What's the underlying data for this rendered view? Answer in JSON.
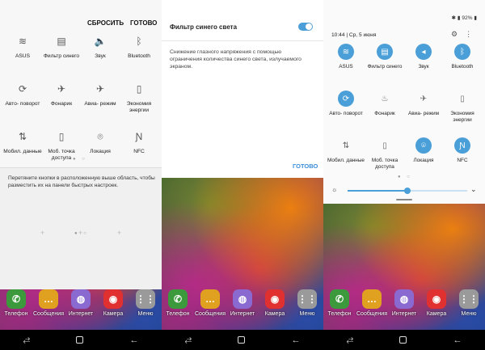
{
  "panel1": {
    "reset_label": "СБРОСИТЬ",
    "done_label": "ГОТОВО",
    "tiles": [
      {
        "label": "ASUS",
        "icon": "wifi-icon",
        "glyph": "≋"
      },
      {
        "label": "Фильтр синего",
        "icon": "blue-filter-icon",
        "glyph": "▤"
      },
      {
        "label": "Звук",
        "icon": "sound-icon",
        "glyph": "🔈"
      },
      {
        "label": "Bluetooth",
        "icon": "bluetooth-icon",
        "glyph": "ᛒ"
      },
      {
        "label": "Авто- поворот",
        "icon": "rotate-icon",
        "glyph": "⟳"
      },
      {
        "label": "Фонарик",
        "icon": "flashlight-icon",
        "glyph": "✈"
      },
      {
        "label": "Авиа- режим",
        "icon": "airplane-icon",
        "glyph": "✈"
      },
      {
        "label": "Экономия энергии",
        "icon": "battery-icon",
        "glyph": "▯"
      },
      {
        "label": "Мобил. данные",
        "icon": "mobile-data-icon",
        "glyph": "⇅"
      },
      {
        "label": "Моб. точка доступа",
        "icon": "hotspot-icon",
        "glyph": "▯"
      },
      {
        "label": "Локация",
        "icon": "location-icon",
        "glyph": "⌾"
      },
      {
        "label": "NFC",
        "icon": "nfc-icon",
        "glyph": "Ɲ"
      }
    ],
    "hint": "Перетяните кнопки в расположенную выше область, чтобы разместить их на панели быстрых настроек."
  },
  "panel2": {
    "title": "Фильтр синего света",
    "description": "Снижение глазного напряжения с помощью ограничения количества синего света, излучаемого экраном.",
    "done_label": "ГОТОВО",
    "toggle_on": true
  },
  "panel3": {
    "battery": "92%",
    "datetime": "10:44 | Ср, 5 июня",
    "tiles": [
      {
        "label": "ASUS",
        "icon": "wifi-icon",
        "glyph": "≋",
        "on": true
      },
      {
        "label": "Фильтр синего",
        "icon": "blue-filter-icon",
        "glyph": "▤",
        "on": true
      },
      {
        "label": "Звук",
        "icon": "sound-icon",
        "glyph": "◂",
        "on": true
      },
      {
        "label": "Bluetooth",
        "icon": "bluetooth-icon",
        "glyph": "ᛒ",
        "on": true
      },
      {
        "label": "Авто- поворот",
        "icon": "rotate-icon",
        "glyph": "⟳",
        "on": true
      },
      {
        "label": "Фонарик",
        "icon": "flashlight-icon",
        "glyph": "♨",
        "on": false
      },
      {
        "label": "Авиа- режим",
        "icon": "airplane-icon",
        "glyph": "✈",
        "on": false
      },
      {
        "label": "Экономия энергии",
        "icon": "battery-icon",
        "glyph": "▯",
        "on": false
      },
      {
        "label": "Мобил. данные",
        "icon": "mobile-data-icon",
        "glyph": "⇅",
        "on": false
      },
      {
        "label": "Моб. точка доступа",
        "icon": "hotspot-icon",
        "glyph": "▯",
        "on": false
      },
      {
        "label": "Локация",
        "icon": "location-icon",
        "glyph": "⌾",
        "on": true
      },
      {
        "label": "NFC",
        "icon": "nfc-icon",
        "glyph": "Ɲ",
        "on": true
      }
    ],
    "brightness": 0.5
  },
  "dock": [
    {
      "label": "Телефон",
      "color": "#3c9a3c",
      "glyph": "✆"
    },
    {
      "label": "Сообщения",
      "color": "#e0a020",
      "glyph": "…"
    },
    {
      "label": "Интернет",
      "color": "#8a6ad0",
      "glyph": "◍"
    },
    {
      "label": "Камера",
      "color": "#e03030",
      "glyph": "◉"
    },
    {
      "label": "Меню",
      "color": "#9a9a9a",
      "glyph": "⋮⋮"
    }
  ],
  "colors": {
    "accent": "#4a9fd8"
  }
}
